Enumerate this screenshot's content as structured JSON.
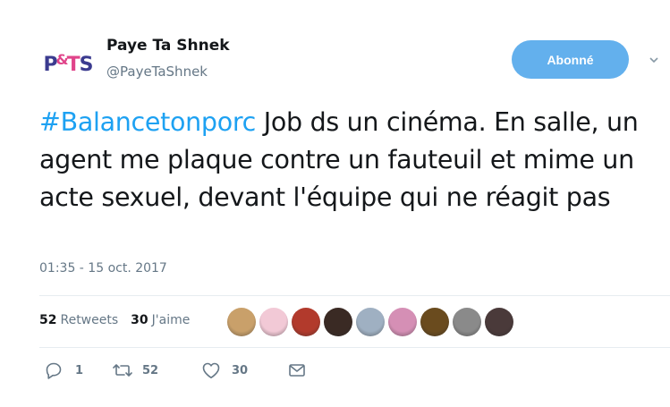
{
  "author": {
    "avatar_text": {
      "p": "P",
      "amp": "&",
      "t": "T",
      "s": "S"
    },
    "display_name": "Paye Ta Shnek",
    "handle": "@PayeTaShnek"
  },
  "follow_button": {
    "label": "Abonné"
  },
  "tweet": {
    "hashtag": "#Balancetonporc",
    "text": " Job ds un cinéma. En salle, un agent me plaque contre un fauteuil et mime un acte sexuel, devant l'équipe qui ne réagit pas"
  },
  "timestamp": "01:35 - 15 oct. 2017",
  "stats": {
    "retweets_count": "52",
    "retweets_label": "Retweets",
    "likes_count": "30",
    "likes_label": "J'aime"
  },
  "liker_avatars": [
    {
      "color": "#c9a06a"
    },
    {
      "color": "#f2c9d6"
    },
    {
      "color": "#b23a2c"
    },
    {
      "color": "#3a2a24"
    },
    {
      "color": "#9fb0c2"
    },
    {
      "color": "#d58fb5"
    },
    {
      "color": "#6a4b1e"
    },
    {
      "color": "#8a8a8a"
    },
    {
      "color": "#4a3a3a"
    }
  ],
  "actions": {
    "reply_count": "1",
    "retweet_count": "52",
    "like_count": "30"
  },
  "colors": {
    "accent": "#1da1f2",
    "button": "#63b0ed",
    "muted": "#657786"
  }
}
